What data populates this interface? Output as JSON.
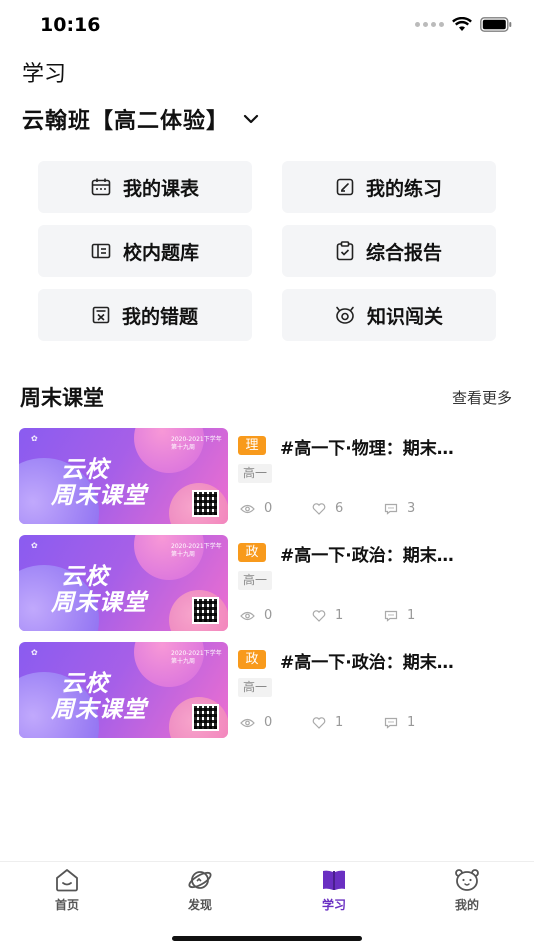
{
  "status_bar": {
    "time": "10:16"
  },
  "header": {
    "page_label": "学习",
    "class_name": "云翰班【高二体验】"
  },
  "grid": [
    {
      "label": "我的课表",
      "icon": "calendar-icon"
    },
    {
      "label": "我的练习",
      "icon": "edit-icon"
    },
    {
      "label": "校内题库",
      "icon": "ticket-icon"
    },
    {
      "label": "综合报告",
      "icon": "clipboard-icon"
    },
    {
      "label": "我的错题",
      "icon": "error-book-icon"
    },
    {
      "label": "知识闯关",
      "icon": "target-icon"
    }
  ],
  "section": {
    "title": "周末课堂",
    "more": "查看更多"
  },
  "courses": [
    {
      "subject": "理",
      "title": "#高一下·物理：期末…",
      "grade": "高一",
      "views": "0",
      "likes": "6",
      "comments": "3",
      "thumb_line1": "云校",
      "thumb_line2": "周末课堂",
      "thumb_date": "2020-2021下学年\n第十九周"
    },
    {
      "subject": "政",
      "title": "#高一下·政治：期末…",
      "grade": "高一",
      "views": "0",
      "likes": "1",
      "comments": "1",
      "thumb_line1": "云校",
      "thumb_line2": "周末课堂",
      "thumb_date": "2020-2021下学年\n第十九周"
    },
    {
      "subject": "政",
      "title": "#高一下·政治：期末…",
      "grade": "高一",
      "views": "0",
      "likes": "1",
      "comments": "1",
      "thumb_line1": "云校",
      "thumb_line2": "周末课堂",
      "thumb_date": "2020-2021下学年\n第十九周"
    }
  ],
  "tabbar": {
    "items": [
      {
        "label": "首页",
        "icon": "home-icon"
      },
      {
        "label": "发现",
        "icon": "planet-icon"
      },
      {
        "label": "学习",
        "icon": "book-icon"
      },
      {
        "label": "我的",
        "icon": "bear-face-icon"
      }
    ],
    "active_index": 2
  },
  "colors": {
    "accent": "#6a2fc2",
    "subject_badge": "#f89a1c",
    "tile_bg": "#f4f5f7"
  }
}
